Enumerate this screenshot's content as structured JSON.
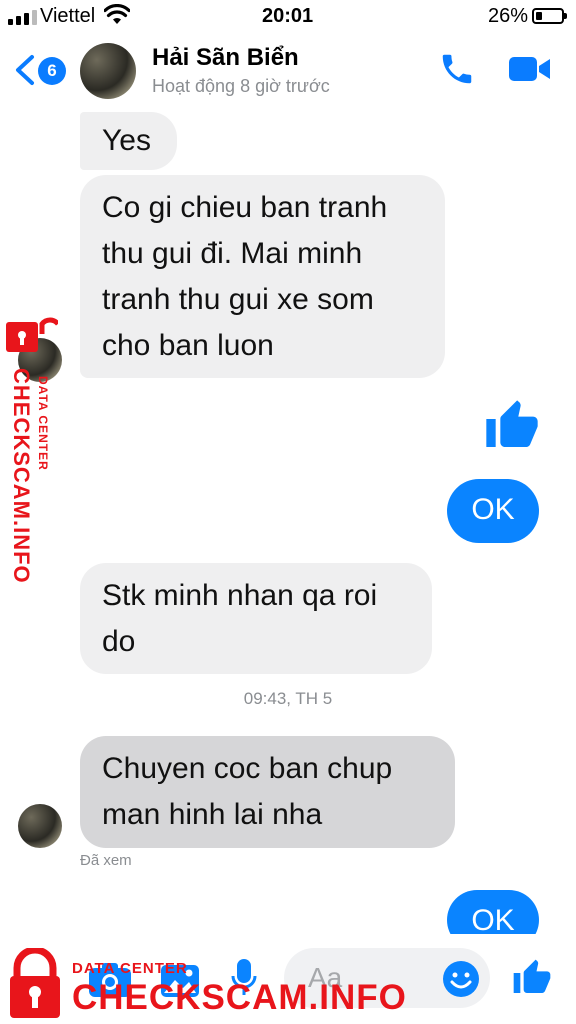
{
  "status_bar": {
    "carrier": "Viettel",
    "time": "20:01",
    "battery": "26%",
    "battery_level": 0.26
  },
  "header": {
    "back_badge": "6",
    "contact_name": "Hải Sãn Biển",
    "contact_status": "Hoạt động 8 giờ trước",
    "accent_color": "#0a7cff"
  },
  "messages": [
    {
      "direction": "incoming",
      "text": "Yes"
    },
    {
      "direction": "incoming",
      "text": "Co gi chieu ban tranh thu gui đi. Mai minh tranh thu gui xe som cho ban luon"
    },
    {
      "direction": "outgoing",
      "type": "like-sticker"
    },
    {
      "direction": "outgoing",
      "text": "OK"
    },
    {
      "direction": "incoming",
      "text": "Stk minh nhan qa roi do"
    },
    {
      "direction": "incoming",
      "text": "Chuyen coc ban chup man hinh lai nha"
    },
    {
      "direction": "outgoing",
      "text": "OK"
    }
  ],
  "timestamp": "09:43, TH 5",
  "seen_label": "Đã xem",
  "composer": {
    "placeholder": "Aa"
  },
  "watermark": {
    "brand": "CHECKSCAM.INFO",
    "tag": "DATA CENTER",
    "color": "#e8151b"
  }
}
